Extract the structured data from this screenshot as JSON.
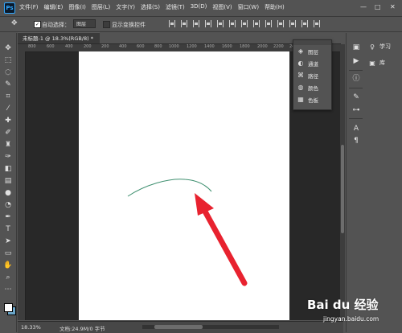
{
  "menubar": {
    "logo": "Ps",
    "items": [
      "文件(F)",
      "编辑(E)",
      "图像(I)",
      "图层(L)",
      "文字(Y)",
      "选择(S)",
      "滤镜(T)",
      "3D(D)",
      "视图(V)",
      "窗口(W)",
      "帮助(H)"
    ],
    "minimize": "—",
    "maximize": "□",
    "close": "✕"
  },
  "options": {
    "auto_select_label": "自动选择：",
    "auto_select_value": "图层",
    "show_transform_label": "显示变换控件"
  },
  "document": {
    "tab_title": "未标题-1 @ 18.3%(RGB/8) *",
    "ruler_labels": [
      "800",
      "600",
      "400",
      "200",
      "0",
      "200",
      "400",
      "600",
      "800",
      "1000",
      "1200",
      "1400",
      "1600",
      "1800",
      "2000",
      "2200",
      "2400",
      "2600",
      "2800"
    ]
  },
  "status": {
    "zoom": "18.33%",
    "doc_info": "文档:24.9M/0 字节"
  },
  "layers_panel": {
    "items": [
      {
        "label": "图层",
        "icon": "layers-icon",
        "glyph": "◈"
      },
      {
        "label": "通道",
        "icon": "channels-icon",
        "glyph": "◐"
      },
      {
        "label": "路径",
        "icon": "paths-icon",
        "glyph": "⌘"
      },
      {
        "label": "颜色",
        "icon": "color-icon",
        "glyph": "◍"
      },
      {
        "label": "色板",
        "icon": "swatches-icon",
        "glyph": "▦"
      }
    ]
  },
  "right_dock": {
    "items": [
      {
        "label": "学习",
        "icon": "learn-icon",
        "glyph": "♀"
      },
      {
        "label": "库",
        "icon": "library-icon",
        "glyph": "▣"
      }
    ]
  },
  "colors": {
    "foreground": "#ffffff",
    "background": "#6aa5c8",
    "stroke": "#3e8f6f",
    "arrow": "#e8222f"
  },
  "watermark": {
    "main": "Bai du 经验",
    "sub": "jingyan.baidu.com"
  }
}
